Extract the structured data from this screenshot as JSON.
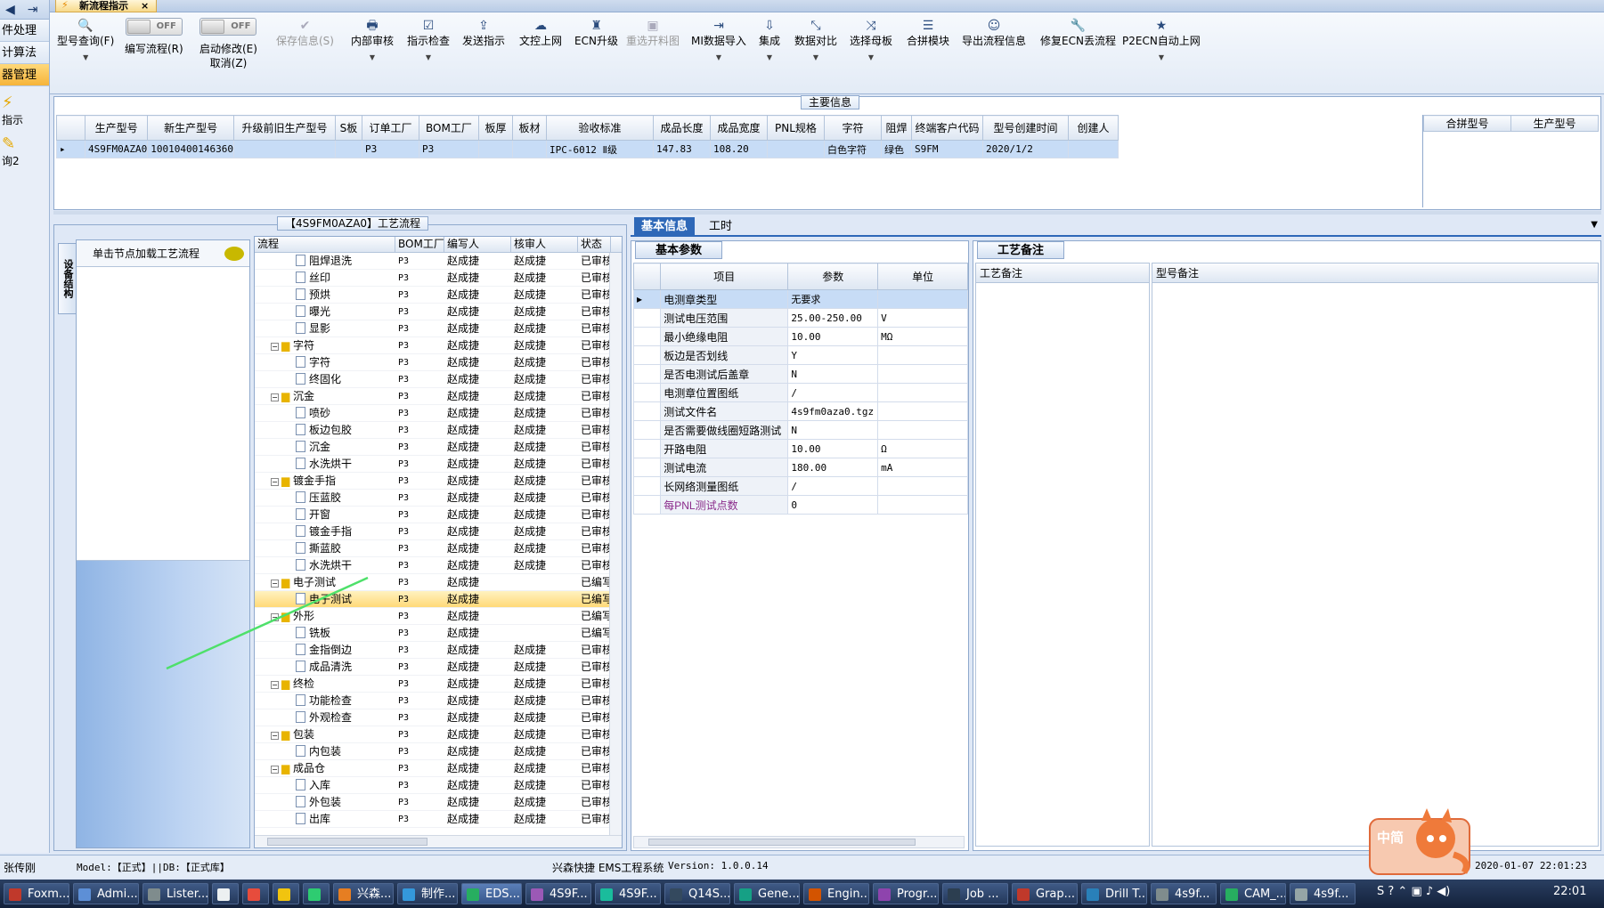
{
  "leftnav": {
    "items": [
      "件处理",
      "计算法",
      "器管理"
    ],
    "icon_labels": [
      "指示",
      "询2"
    ]
  },
  "tab": {
    "title": "新流程指示",
    "close": "×"
  },
  "toolbar": {
    "buttons": [
      {
        "label": "型号查询(F)",
        "icon": "🔍"
      },
      {
        "label": "编写流程(R)",
        "toggle": "OFF"
      },
      {
        "label": "启动修改(E)",
        "toggle": "OFF",
        "sub": "取消(Z)"
      },
      {
        "label": "保存信息(S)",
        "icon": "✔"
      },
      {
        "label": "内部审核",
        "icon": "🖶"
      },
      {
        "label": "指示检查",
        "icon": "☑"
      },
      {
        "label": "发送指示",
        "icon": "⇪"
      },
      {
        "label": "文控上网",
        "icon": "☁"
      },
      {
        "label": "ECN升级",
        "icon": "♜"
      },
      {
        "label": "重选开料图",
        "icon": "▣"
      },
      {
        "label": "MI数据导入",
        "icon": "⇥"
      },
      {
        "label": "集成",
        "icon": "⇩"
      },
      {
        "label": "数据对比",
        "icon": "⤡"
      },
      {
        "label": "选择母板",
        "icon": "⤨"
      },
      {
        "label": "合拼模块",
        "icon": "☰"
      },
      {
        "label": "导出流程信息",
        "icon": "☺"
      },
      {
        "label": "修复ECN丢流程",
        "icon": "🔧"
      },
      {
        "label": "P2ECN自动上网",
        "icon": "★"
      }
    ]
  },
  "main_info": {
    "label": "主要信息",
    "columns": [
      "生产型号",
      "新生产型号",
      "升级前旧生产型号",
      "S板",
      "订单工厂",
      "BOM工厂",
      "板厚",
      "板材",
      "验收标准",
      "成品长度",
      "成品宽度",
      "PNL规格",
      "字符",
      "阻焊",
      "终端客户代码",
      "型号创建时间",
      "创建人"
    ],
    "row": [
      "4S9FM0AZA0",
      "10010400146360",
      "",
      "",
      "P3",
      "P3",
      "",
      "",
      "IPC-6012 Ⅱ级",
      "147.83",
      "108.20",
      "",
      "白色字符",
      "绿色",
      "S9FM",
      "2020/1/2",
      ""
    ],
    "comb_columns": [
      "合拼型号",
      "生产型号"
    ]
  },
  "process": {
    "panel_label": "【4S9FM0AZA0】工艺流程",
    "vertical_tab": "设备结构",
    "card_head": "单击节点加载工艺流程",
    "columns": [
      "流程",
      "BOM工厂",
      "编写人",
      "核审人",
      "状态"
    ],
    "rows": [
      {
        "name": "阻焊退洗",
        "level": 2,
        "bom": "P3",
        "writer": "赵成捷",
        "reviewer": "赵成捷",
        "status": "已审核"
      },
      {
        "name": "丝印",
        "level": 2,
        "bom": "P3",
        "writer": "赵成捷",
        "reviewer": "赵成捷",
        "status": "已审核"
      },
      {
        "name": "预烘",
        "level": 2,
        "bom": "P3",
        "writer": "赵成捷",
        "reviewer": "赵成捷",
        "status": "已审核"
      },
      {
        "name": "曝光",
        "level": 2,
        "bom": "P3",
        "writer": "赵成捷",
        "reviewer": "赵成捷",
        "status": "已审核"
      },
      {
        "name": "显影",
        "level": 2,
        "bom": "P3",
        "writer": "赵成捷",
        "reviewer": "赵成捷",
        "status": "已审核"
      },
      {
        "name": "字符",
        "level": 1,
        "bom": "P3",
        "writer": "赵成捷",
        "reviewer": "赵成捷",
        "status": "已审核"
      },
      {
        "name": "字符",
        "level": 2,
        "bom": "P3",
        "writer": "赵成捷",
        "reviewer": "赵成捷",
        "status": "已审核"
      },
      {
        "name": "终固化",
        "level": 2,
        "bom": "P3",
        "writer": "赵成捷",
        "reviewer": "赵成捷",
        "status": "已审核"
      },
      {
        "name": "沉金",
        "level": 1,
        "bom": "P3",
        "writer": "赵成捷",
        "reviewer": "赵成捷",
        "status": "已审核"
      },
      {
        "name": "喷砂",
        "level": 2,
        "bom": "P3",
        "writer": "赵成捷",
        "reviewer": "赵成捷",
        "status": "已审核"
      },
      {
        "name": "板边包胶",
        "level": 2,
        "bom": "P3",
        "writer": "赵成捷",
        "reviewer": "赵成捷",
        "status": "已审核"
      },
      {
        "name": "沉金",
        "level": 2,
        "bom": "P3",
        "writer": "赵成捷",
        "reviewer": "赵成捷",
        "status": "已审核"
      },
      {
        "name": "水洗烘干",
        "level": 2,
        "bom": "P3",
        "writer": "赵成捷",
        "reviewer": "赵成捷",
        "status": "已审核"
      },
      {
        "name": "镀金手指",
        "level": 1,
        "bom": "P3",
        "writer": "赵成捷",
        "reviewer": "赵成捷",
        "status": "已审核"
      },
      {
        "name": "压蓝胶",
        "level": 2,
        "bom": "P3",
        "writer": "赵成捷",
        "reviewer": "赵成捷",
        "status": "已审核"
      },
      {
        "name": "开窗",
        "level": 2,
        "bom": "P3",
        "writer": "赵成捷",
        "reviewer": "赵成捷",
        "status": "已审核"
      },
      {
        "name": "镀金手指",
        "level": 2,
        "bom": "P3",
        "writer": "赵成捷",
        "reviewer": "赵成捷",
        "status": "已审核"
      },
      {
        "name": "撕蓝胶",
        "level": 2,
        "bom": "P3",
        "writer": "赵成捷",
        "reviewer": "赵成捷",
        "status": "已审核"
      },
      {
        "name": "水洗烘干",
        "level": 2,
        "bom": "P3",
        "writer": "赵成捷",
        "reviewer": "赵成捷",
        "status": "已审核"
      },
      {
        "name": "电子测试",
        "level": 1,
        "bom": "P3",
        "writer": "赵成捷",
        "reviewer": "",
        "status": "已编写"
      },
      {
        "name": "电子测试",
        "level": 2,
        "bom": "P3",
        "writer": "赵成捷",
        "reviewer": "",
        "status": "已编写",
        "selected": true
      },
      {
        "name": "外形",
        "level": 1,
        "bom": "P3",
        "writer": "赵成捷",
        "reviewer": "",
        "status": "已编写"
      },
      {
        "name": "铣板",
        "level": 2,
        "bom": "P3",
        "writer": "赵成捷",
        "reviewer": "",
        "status": "已编写"
      },
      {
        "name": "金指倒边",
        "level": 2,
        "bom": "P3",
        "writer": "赵成捷",
        "reviewer": "赵成捷",
        "status": "已审核"
      },
      {
        "name": "成品清洗",
        "level": 2,
        "bom": "P3",
        "writer": "赵成捷",
        "reviewer": "赵成捷",
        "status": "已审核"
      },
      {
        "name": "终检",
        "level": 1,
        "bom": "P3",
        "writer": "赵成捷",
        "reviewer": "赵成捷",
        "status": "已审核"
      },
      {
        "name": "功能检查",
        "level": 2,
        "bom": "P3",
        "writer": "赵成捷",
        "reviewer": "赵成捷",
        "status": "已审核"
      },
      {
        "name": "外观检查",
        "level": 2,
        "bom": "P3",
        "writer": "赵成捷",
        "reviewer": "赵成捷",
        "status": "已审核"
      },
      {
        "name": "包装",
        "level": 1,
        "bom": "P3",
        "writer": "赵成捷",
        "reviewer": "赵成捷",
        "status": "已审核"
      },
      {
        "name": "内包装",
        "level": 2,
        "bom": "P3",
        "writer": "赵成捷",
        "reviewer": "赵成捷",
        "status": "已审核"
      },
      {
        "name": "成品仓",
        "level": 1,
        "bom": "P3",
        "writer": "赵成捷",
        "reviewer": "赵成捷",
        "status": "已审核"
      },
      {
        "name": "入库",
        "level": 2,
        "bom": "P3",
        "writer": "赵成捷",
        "reviewer": "赵成捷",
        "status": "已审核"
      },
      {
        "name": "外包装",
        "level": 2,
        "bom": "P3",
        "writer": "赵成捷",
        "reviewer": "赵成捷",
        "status": "已审核"
      },
      {
        "name": "出库",
        "level": 2,
        "bom": "P3",
        "writer": "赵成捷",
        "reviewer": "赵成捷",
        "status": "已审核"
      }
    ]
  },
  "right_tabs": [
    "基本信息",
    "工时"
  ],
  "basic": {
    "title": "基本参数",
    "columns": [
      "项目",
      "参数",
      "单位"
    ],
    "rows": [
      {
        "item": "电测章类型",
        "value": "无要求",
        "unit": "",
        "selected": true
      },
      {
        "item": "测试电压范围",
        "value": "25.00-250.00",
        "unit": "V"
      },
      {
        "item": "最小绝缘电阻",
        "value": "10.00",
        "unit": "MΩ"
      },
      {
        "item": "板边是否划线",
        "value": "Y",
        "unit": ""
      },
      {
        "item": "是否电测试后盖章",
        "value": "N",
        "unit": ""
      },
      {
        "item": "电测章位置图纸",
        "value": "/",
        "unit": ""
      },
      {
        "item": "测试文件名",
        "value": "4s9fm0aza0.tgz",
        "unit": ""
      },
      {
        "item": "是否需要做线圈短路测试",
        "value": "N",
        "unit": ""
      },
      {
        "item": "开路电阻",
        "value": "10.00",
        "unit": "Ω"
      },
      {
        "item": "测试电流",
        "value": "180.00",
        "unit": "mA"
      },
      {
        "item": "长网络测量图纸",
        "value": "/",
        "unit": ""
      },
      {
        "item": "每PNL测试点数",
        "value": "0",
        "unit": "",
        "purple": true
      }
    ]
  },
  "remark": {
    "title": "工艺备注",
    "columns": [
      "工艺备注",
      "型号备注"
    ]
  },
  "statusbar": {
    "user": "张传刚",
    "model": "Model:【正式】||DB:【正式库】",
    "app": "兴森快捷 EMS工程系统",
    "version": "Version: 1.0.0.14",
    "datetime": "2020-01-07 22:01:23"
  },
  "mascot_text": "中简",
  "taskbar": {
    "items": [
      "Foxm...",
      "Admi...",
      "Lister...",
      "",
      "",
      "",
      "",
      "兴森...",
      "制作...",
      "EDS...",
      "4S9F...",
      "4S9F...",
      "Q14S...",
      "Gene...",
      "Engin...",
      "Progr...",
      "Job ...",
      "Grap...",
      "Drill T...",
      "4s9f...",
      "CAM_...",
      "4s9f..."
    ],
    "clock": "22:01"
  }
}
